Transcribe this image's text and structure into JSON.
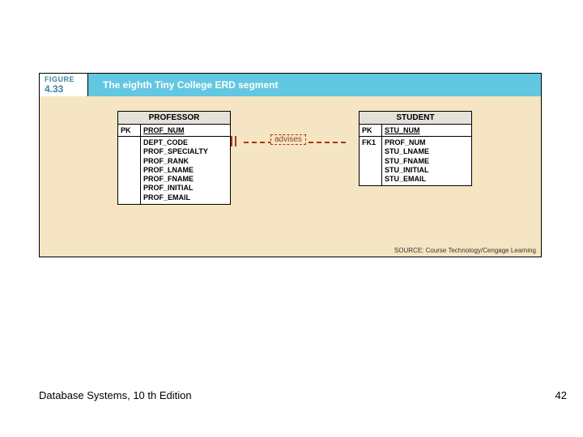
{
  "figure": {
    "label": "FIGURE",
    "number": "4.33",
    "title": "The eighth Tiny College ERD segment"
  },
  "entities": {
    "professor": {
      "name": "PROFESSOR",
      "pk_label": "PK",
      "pk_attr": "PROF_NUM",
      "fk_label": "",
      "attrs": [
        "DEPT_CODE",
        "PROF_SPECIALTY",
        "PROF_RANK",
        "PROF_LNAME",
        "PROF_FNAME",
        "PROF_INITIAL",
        "PROF_EMAIL"
      ]
    },
    "student": {
      "name": "STUDENT",
      "pk_label": "PK",
      "pk_attr": "STU_NUM",
      "fk_label": "FK1",
      "attrs": [
        "PROF_NUM",
        "STU_LNAME",
        "STU_FNAME",
        "STU_INITIAL",
        "STU_EMAIL"
      ]
    }
  },
  "relationship": {
    "label": "advises"
  },
  "source_credit": "SOURCE: Course Technology/Cengage Learning",
  "footer": "Database Systems, 10 th Edition",
  "page_number": "42"
}
